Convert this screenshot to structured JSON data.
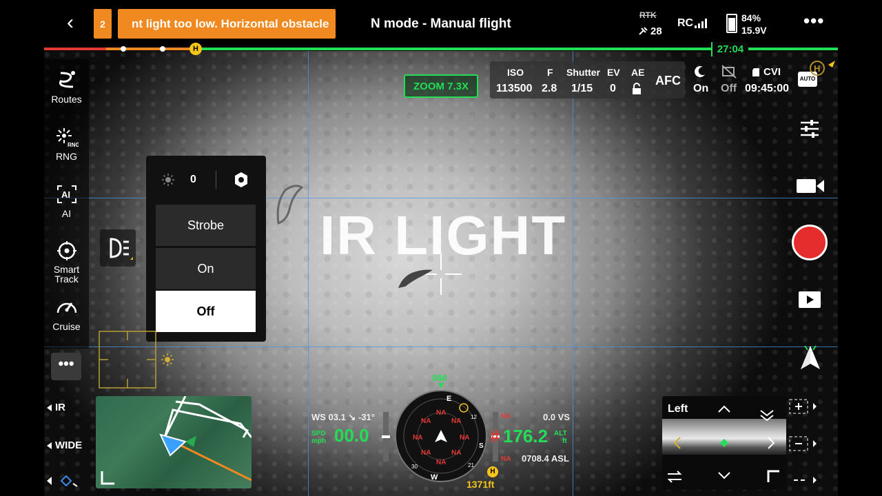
{
  "topbar": {
    "back_label": "‹",
    "warning_count": "2",
    "warning_text": "nt light too low. Horizontal obstacle",
    "flight_mode": "N mode - Manual flight",
    "rtk_label": "RTK",
    "satellite_count": "28",
    "rc_label": "RC",
    "battery_percent": "84%",
    "battery_voltage": "15.9V",
    "more_label": "•••"
  },
  "timeline": {
    "home_label": "H",
    "time_remaining": "27:04"
  },
  "sidebar": {
    "items": [
      {
        "label": "Routes"
      },
      {
        "label": "RNG"
      },
      {
        "label": "AI"
      },
      {
        "label": "Smart Track"
      },
      {
        "label": "Cruise"
      }
    ],
    "more_label": "•••",
    "icon_text_rng": "RNG",
    "icon_text_ai": "AI"
  },
  "light_menu": {
    "brightness": "0",
    "options": [
      {
        "label": "Strobe",
        "selected": false
      },
      {
        "label": "On",
        "selected": false
      },
      {
        "label": "Off",
        "selected": true
      }
    ]
  },
  "overlay": {
    "ir_text": "IR LIGHT"
  },
  "camera": {
    "zoom": "ZOOM  7.3X",
    "iso_label": "ISO",
    "iso_value": "113500",
    "f_label": "F",
    "f_value": "2.8",
    "shutter_label": "Shutter",
    "shutter_value": "1/15",
    "ev_label": "EV",
    "ev_value": "0",
    "ae_label": "AE",
    "focus_mode": "AFC",
    "night_mode_value": "On",
    "dewarp_value": "Off",
    "storage_label": "CVI",
    "recording_time": "09:45:00",
    "auto_label": "AUTO"
  },
  "lens_selector": {
    "ir_label": "IR",
    "wide_label": "WIDE"
  },
  "instruments": {
    "wind": "WS 03.1 ↘ -31°",
    "speed_unit_line1": "SPD",
    "speed_unit_line2": "mph",
    "speed_value": "00.0",
    "heading": "080",
    "compass_e": "E",
    "compass_s": "S",
    "compass_w": "W",
    "compass_30": "30",
    "compass_12": "12",
    "compass_21": "21",
    "na_label": "NA",
    "altitude_prefix": "#",
    "altitude_value": "176.2",
    "altitude_unit_line1": "ALT",
    "altitude_unit_line2": "ft",
    "vertical_speed": "0.0 VS",
    "asl": "0708.4 ASL",
    "home_distance": "1371ft",
    "home_label": "H"
  },
  "pip": {
    "label": "Left"
  },
  "colors": {
    "warning": "#f0891f",
    "accent_green": "#22dd55",
    "record_red": "#e52d2d",
    "grid_blue": "#5096e6",
    "home_yellow": "#f5c518"
  }
}
